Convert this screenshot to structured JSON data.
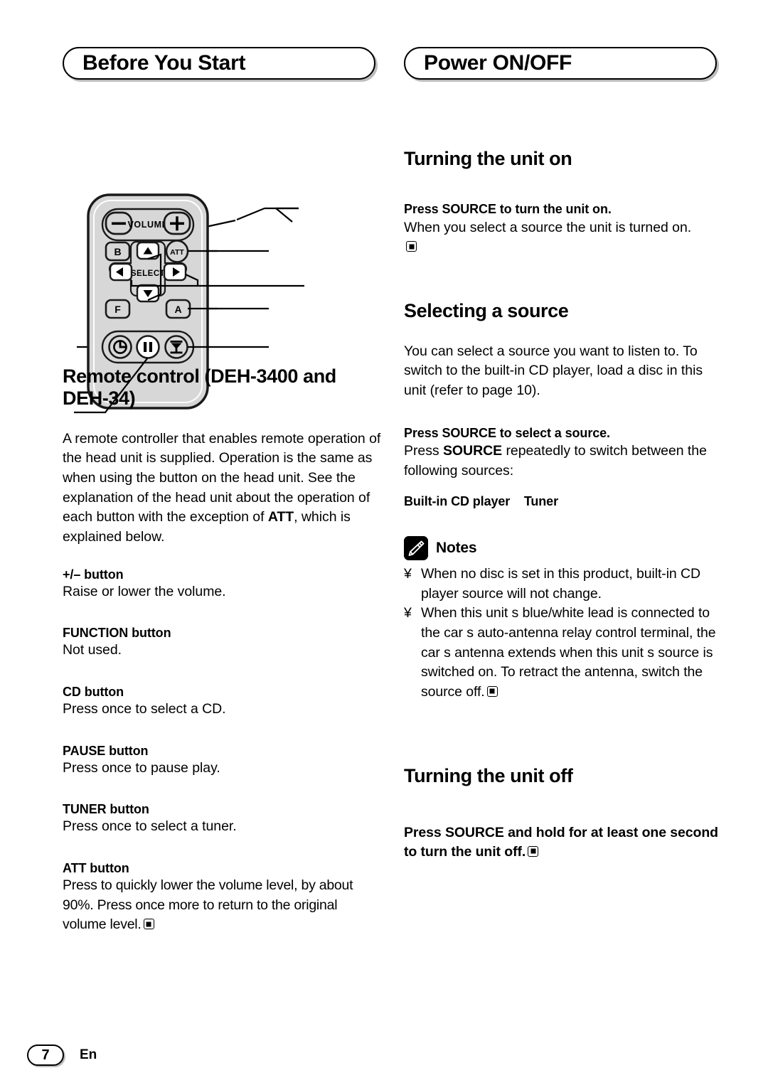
{
  "headers": {
    "left": "Before You Start",
    "right": "Power ON/OFF"
  },
  "remote": {
    "caption_buttons": {
      "volume_label": "VOLUME",
      "minus": "–",
      "plus": "+",
      "b": "B",
      "att": "ATT",
      "select_label": "SELECT",
      "up": "▲",
      "down": "▼",
      "left": "◀",
      "right": "▶",
      "f": "F",
      "a": "A",
      "power_icon": "power-icon",
      "pause_icon": "pause-icon",
      "eject_icon": "eject-disc-icon"
    },
    "body_color": "#d7d7d7"
  },
  "left_column": {
    "heading": "Remote control (DEH-3400 and DEH-34)",
    "intro_pre": "A remote controller that enables remote operation of the head unit is supplied. Operation is the same as when using the button on the head unit. See the explanation of the head unit about the operation of each button with the exception of ",
    "intro_bold": "ATT",
    "intro_post": ", which is explained below.",
    "items": [
      {
        "title": "+/– button",
        "text": "Raise or lower the volume."
      },
      {
        "title": "FUNCTION button",
        "text": "Not used."
      },
      {
        "title": "CD button",
        "text": "Press once to select a CD."
      },
      {
        "title": "PAUSE button",
        "text": "Press once to pause play."
      },
      {
        "title": "TUNER button",
        "text": "Press once to select a tuner."
      }
    ],
    "att_item": {
      "title": "ATT button",
      "text": "Press to quickly lower the volume level, by about 90%. Press once more to return to the original volume level."
    }
  },
  "right_column": {
    "turning_on": {
      "heading": "Turning the unit on",
      "lead_pre": "Press ",
      "lead_bold": "SOURCE",
      "lead_post": " to turn the unit on.",
      "body": "When you select a source the unit is turned on."
    },
    "selecting_source": {
      "heading": "Selecting a source",
      "body": "You can select a source you want to listen to. To switch to the built-in CD player, load a disc in this unit (refer to page 10).",
      "lead_pre": "Press ",
      "lead_bold": "SOURCE",
      "lead_post": " to select a source.",
      "instr_pre": "Press ",
      "instr_bold": "SOURCE",
      "instr_post": " repeatedly to switch between the following sources:",
      "sources_line": "Built-in CD player    Tuner"
    },
    "notes": {
      "title": "Notes",
      "icon": "pencil-icon",
      "bullet": "¥",
      "items": [
        "When no disc is set in this product, built-in CD player source will not change.",
        "When this unit s blue/white lead is connected to the car s auto-antenna relay control terminal, the car s antenna extends when this unit s source is switched on. To retract the antenna, switch the source off."
      ]
    },
    "turning_off": {
      "heading": "Turning the unit off",
      "lead_pre": "Press ",
      "lead_bold": "SOURCE",
      "lead_post": " and hold for at least one second to turn the unit off."
    }
  },
  "footer": {
    "page_number": "7",
    "language": "En"
  }
}
